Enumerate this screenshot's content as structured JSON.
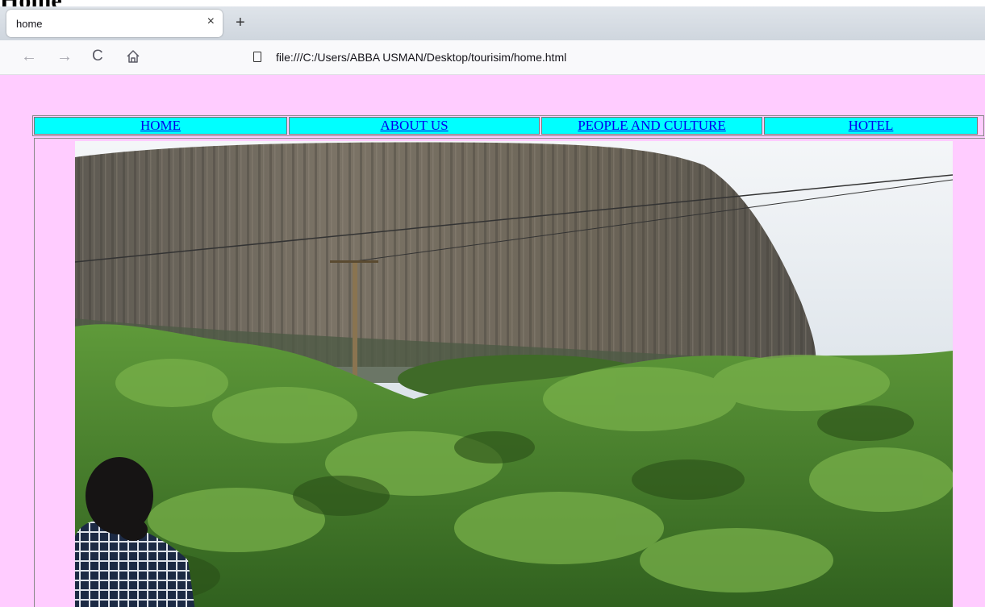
{
  "document": {
    "title": "Home"
  },
  "browser": {
    "tab": {
      "title": "home",
      "close_glyph": "×"
    },
    "new_tab_glyph": "+",
    "nav": {
      "back_glyph": "←",
      "forward_glyph": "→",
      "reload_glyph": "C",
      "home_icon": "home-icon"
    },
    "url": "file:///C:/Users/ABBA USMAN/Desktop/tourisim/home.html"
  },
  "page": {
    "background": "#ffccff",
    "menu_color": "#00ffff",
    "menu": [
      {
        "label": "HOME"
      },
      {
        "label": "ABOUT US"
      },
      {
        "label": "PEOPLE AND CULTURE"
      },
      {
        "label": "HOTEL"
      }
    ],
    "photo": {
      "subject": "rock-formation-with-vegetation"
    }
  }
}
